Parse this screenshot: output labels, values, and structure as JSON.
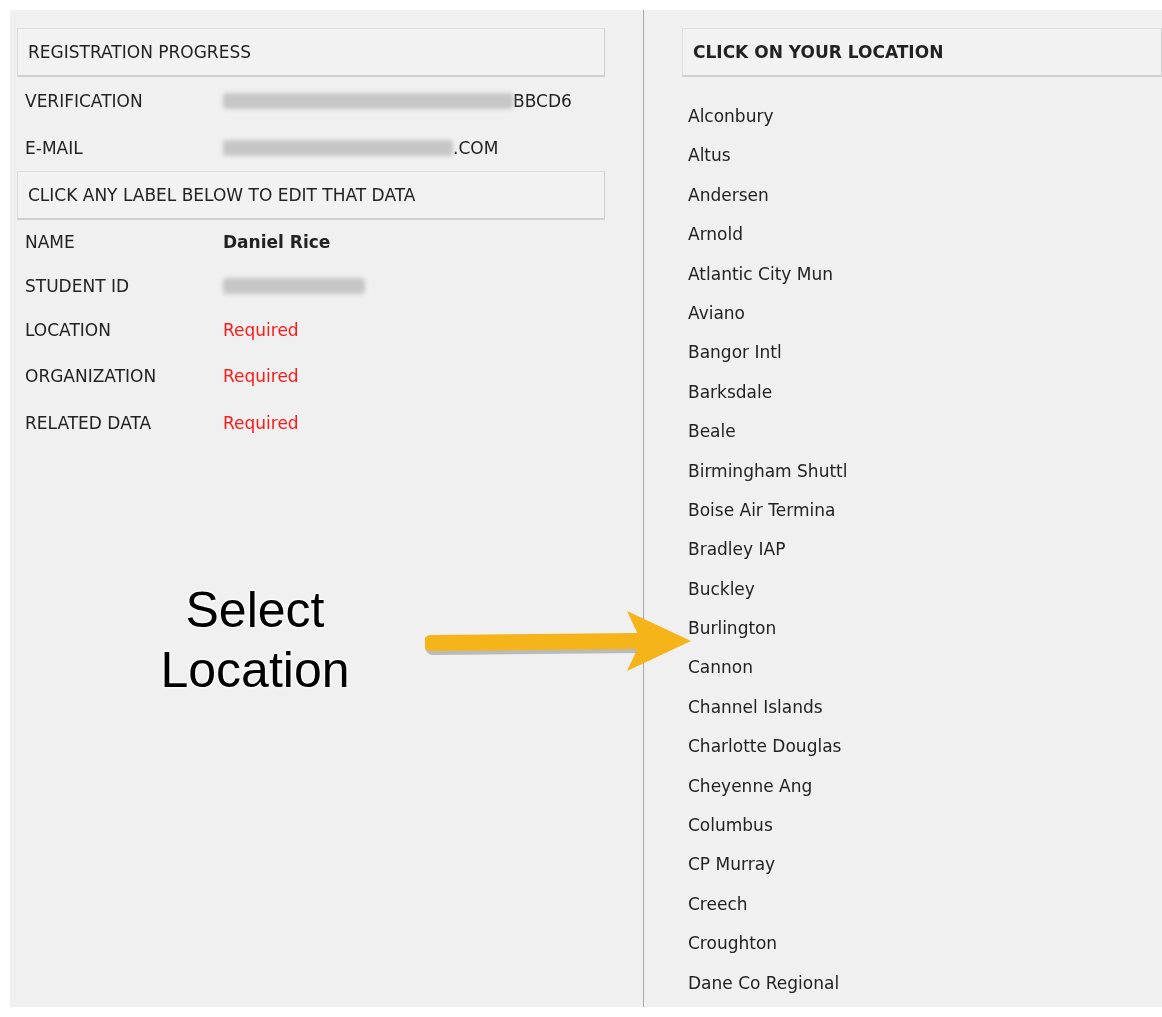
{
  "progress": {
    "title": "REGISTRATION PROGRESS",
    "fields": [
      {
        "label": "VERIFICATION",
        "redacted": true,
        "value": "BBCD6"
      },
      {
        "label": "E-MAIL",
        "redacted": true,
        "value": ".COM"
      }
    ]
  },
  "edit": {
    "title": "CLICK ANY LABEL BELOW TO EDIT THAT DATA",
    "fields": [
      {
        "label": "NAME",
        "kind": "filled",
        "value": "Daniel Rice"
      },
      {
        "label": "STUDENT ID",
        "kind": "redacted"
      },
      {
        "label": "LOCATION",
        "kind": "required",
        "value": "Required"
      },
      {
        "label": "ORGANIZATION",
        "kind": "required",
        "value": "Required"
      },
      {
        "label": "RELATED DATA",
        "kind": "required",
        "value": "Required"
      }
    ]
  },
  "annotation": {
    "text": "Select Location"
  },
  "locations": {
    "title": "CLICK ON YOUR LOCATION",
    "items": [
      "Alconbury",
      "Altus",
      "Andersen",
      "Arnold",
      "Atlantic City Mun",
      "Aviano",
      "Bangor Intl",
      "Barksdale",
      "Beale",
      "Birmingham Shuttl",
      "Boise Air Termina",
      "Bradley IAP",
      "Buckley",
      "Burlington",
      "Cannon",
      "Channel Islands",
      "Charlotte Douglas",
      "Cheyenne Ang",
      "Columbus",
      "CP Murray",
      "Creech",
      "Croughton",
      "Dane Co Regional"
    ]
  }
}
